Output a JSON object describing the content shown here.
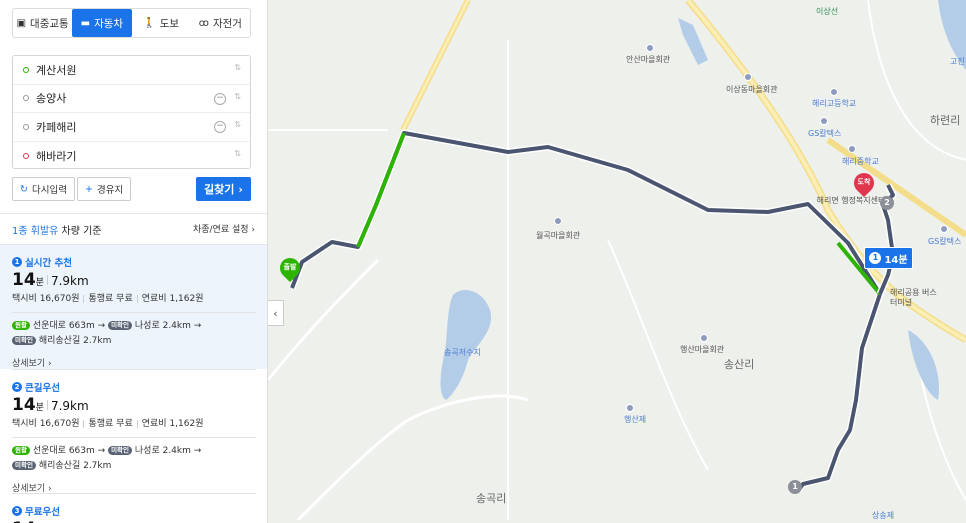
{
  "modes": [
    {
      "label": "대중교통",
      "icon": "bus-icon",
      "active": false
    },
    {
      "label": "자동차",
      "icon": "car-icon",
      "active": true
    },
    {
      "label": "도보",
      "icon": "walk-icon",
      "active": false
    },
    {
      "label": "자전거",
      "icon": "bicycle-icon",
      "active": false
    }
  ],
  "waypoints": [
    "계산서원",
    "송양사",
    "카페해리",
    "해바라기"
  ],
  "buttons": {
    "reset": "다시입력",
    "add": "경유지",
    "search": "길찾기"
  },
  "basis": {
    "fuel": "1종 휘발유",
    "car": "차량 기준",
    "setting": "차종/연료 설정"
  },
  "routes": [
    {
      "num": "1",
      "title": "실시간 추천",
      "time": "14",
      "unit": "분",
      "dist": "7.9km",
      "taxi": "택시비 16,670원",
      "toll": "통행료 무료",
      "fuel": "연료비 1,162원",
      "tag1": "원활",
      "road1": "선운대로 663m →",
      "tag2": "미확인",
      "road2": "나성로 2.4km →",
      "tag3": "미확인",
      "road3": "해리송산길 2.7km",
      "more": "상세보기"
    },
    {
      "num": "2",
      "title": "큰길우선",
      "time": "14",
      "unit": "분",
      "dist": "7.9km",
      "taxi": "택시비 16,670원",
      "toll": "통행료 무료",
      "fuel": "연료비 1,162원",
      "tag1": "원활",
      "road1": "선운대로 663m →",
      "tag2": "미확인",
      "road2": "나성로 2.4km →",
      "tag3": "미확인",
      "road3": "해리송산길 2.7km",
      "more": "상세보기"
    },
    {
      "num": "3",
      "title": "무료우선",
      "time": "14"
    }
  ],
  "map": {
    "labels": [
      "이상선",
      "안산마을회관",
      "이상동마을회관",
      "해리고등학교",
      "GS칼텍스",
      "해리중학교",
      "하련리",
      "해리면 행정복지센터",
      "월곡마을회관",
      "GS칼텍스",
      "해리공용 버스터미널",
      "송곡저수지",
      "행산마을회관",
      "송산리",
      "행산제",
      "송곡리",
      "상송제",
      "고진"
    ],
    "start_label": "출발",
    "end_label": "도착",
    "badge_time": "14분",
    "badge_num": "1",
    "wp_nums": [
      "1",
      "2"
    ]
  },
  "colors": {
    "accent": "#1a73e8",
    "route": "#4a5670",
    "smooth": "#2db400",
    "end": "#e0364e"
  }
}
